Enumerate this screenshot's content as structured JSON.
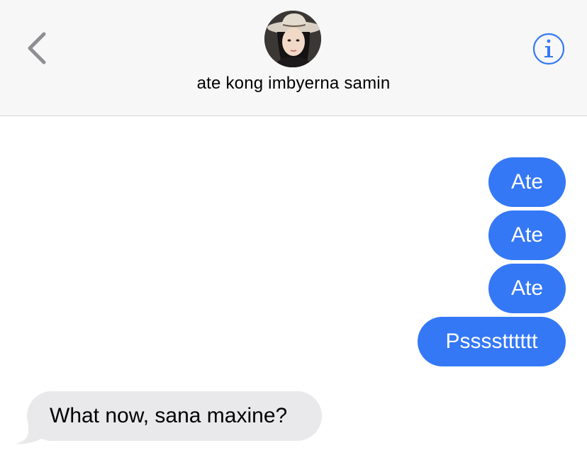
{
  "header": {
    "contact_name": "ate kong imbyerna samin",
    "back_icon": "chevron-left-icon",
    "info_icon": "info-circle-icon",
    "accent_color": "#3478f6"
  },
  "messages": {
    "sent": [
      {
        "text": "Ate"
      },
      {
        "text": "Ate"
      },
      {
        "text": "Ate"
      },
      {
        "text": "Psssstttttt"
      }
    ],
    "received": [
      {
        "text": "What now, sana maxine?"
      }
    ],
    "sent_color": "#3478f6",
    "received_color": "#e9e9eb"
  }
}
